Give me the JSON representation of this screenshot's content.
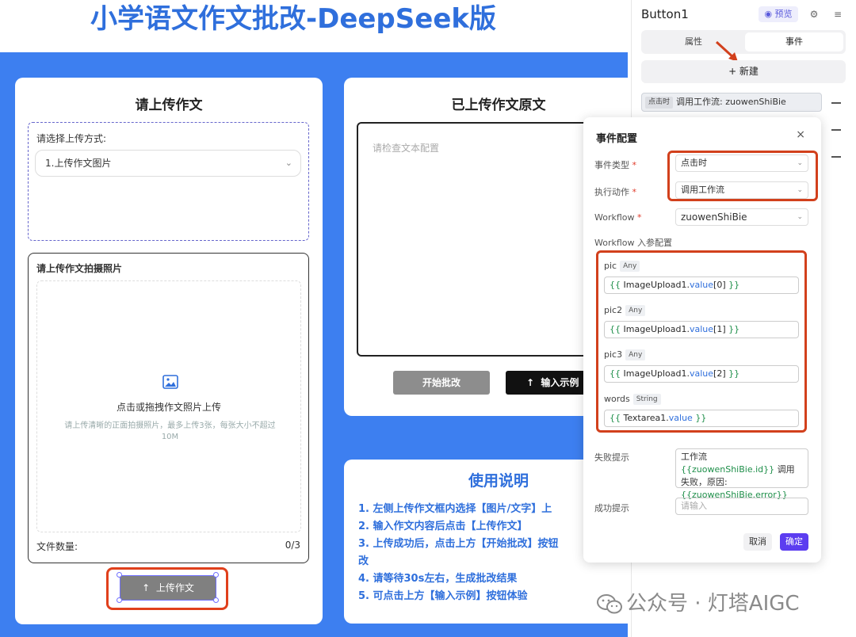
{
  "app": {
    "title": "小学语文作文批改-DeepSeek版"
  },
  "upload_card": {
    "title": "请上传作文",
    "method_label": "请选择上传方式:",
    "method_value": "1.上传作文图片",
    "photo_label": "请上传作文拍摄照片",
    "drop_main": "点击或拖拽作文照片上传",
    "drop_sub": "请上传清晰的正面拍摄照片，最多上传3张，每张大小不超过10M",
    "file_count_label": "文件数量:",
    "file_count_value": "0/3",
    "upload_button": "上传作文"
  },
  "original_card": {
    "title": "已上传作文原文",
    "placeholder": "请检查文本配置",
    "start_button": "开始批改",
    "example_button": "输入示例"
  },
  "guide": {
    "title": "使用说明",
    "items": [
      "1. 左侧上传作文框内选择【图片/文字】上",
      "2. 输入作文内容后点击【上传作文】",
      "3. 上传成功后，点击上方【开始批改】按钮",
      "改",
      "4. 请等待30s左右，生成批改结果",
      "5. 可点击上方【输入示例】按钮体验"
    ]
  },
  "panel": {
    "component_name": "Button1",
    "preview_label": "预览",
    "tabs": [
      "属性",
      "事件"
    ],
    "active_tab": "事件",
    "new_label": "+ 新建",
    "event_tag": "点击时",
    "event_text": "调用工作流: zuowenShiBie"
  },
  "dialog": {
    "title": "事件配置",
    "close": "×",
    "event_type_label": "事件类型",
    "event_type_value": "点击时",
    "action_label": "执行动作",
    "action_value": "调用工作流",
    "workflow_label": "Workflow",
    "workflow_value": "zuowenShiBie",
    "params_section": "Workflow 入参配置",
    "params": [
      {
        "name": "pic",
        "type": "Any",
        "expr_pre": "{{ ",
        "expr_obj": "ImageUpload1",
        "expr_dot": ".",
        "expr_prop": "value",
        "expr_idx": "[0]",
        "expr_post": " }}"
      },
      {
        "name": "pic2",
        "type": "Any",
        "expr_pre": "{{ ",
        "expr_obj": "ImageUpload1",
        "expr_dot": ".",
        "expr_prop": "value",
        "expr_idx": "[1]",
        "expr_post": " }}"
      },
      {
        "name": "pic3",
        "type": "Any",
        "expr_pre": "{{ ",
        "expr_obj": "ImageUpload1",
        "expr_dot": ".",
        "expr_prop": "value",
        "expr_idx": "[2]",
        "expr_post": " }}"
      },
      {
        "name": "words",
        "type": "String",
        "expr_pre": "{{ ",
        "expr_obj": "Textarea1",
        "expr_dot": ".",
        "expr_prop": "value",
        "expr_idx": "",
        "expr_post": " }}"
      }
    ],
    "fail_label": "失败提示",
    "fail_text_1": "工作流 ",
    "fail_expr_1": "{{zuowenShiBie.id}}",
    "fail_text_2": " 调用失败，原因: ",
    "fail_expr_2": "{{zuowenShiBie.error}}",
    "success_label": "成功提示",
    "success_placeholder": "请输入",
    "cancel": "取消",
    "ok": "确定"
  },
  "watermark": {
    "text": "公众号 · 灯塔AIGC"
  },
  "colors": {
    "brand_blue": "#3d7ff0",
    "title_blue": "#2f6fdc",
    "highlight_red": "#d2401c",
    "primary_purple": "#5c3df0"
  }
}
